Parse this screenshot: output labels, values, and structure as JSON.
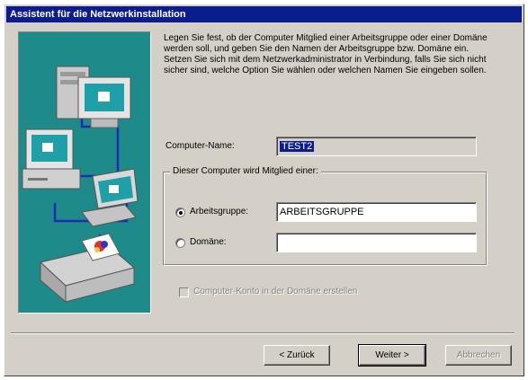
{
  "window": {
    "title": "Assistent für die Netzwerkinstallation"
  },
  "intro_text": "Legen Sie fest, ob der Computer Mitglied einer Arbeitsgruppe oder einer Domäne werden soll, und geben Sie den Namen der Arbeitsgruppe bzw. Domäne ein. Setzen Sie sich mit dem Netzwerkadministrator in Verbindung, falls Sie sich nicht sicher sind, welche Option Sie wählen oder welchen Namen Sie eingeben sollen.",
  "computer_name": {
    "label": "Computer-Name:",
    "value": "TEST2"
  },
  "membership": {
    "group_title": "Dieser Computer wird Mitglied einer:",
    "workgroup": {
      "label": "Arbeitsgruppe:",
      "value": "ARBEITSGRUPPE",
      "selected": true
    },
    "domain": {
      "label": "Domäne:",
      "value": "",
      "selected": false
    }
  },
  "create_account": {
    "label": "Computer-Konto in der Domäne erstellen",
    "checked": false,
    "enabled": false
  },
  "buttons": {
    "back": "< Zurück",
    "next": "Weiter >",
    "cancel": "Abbrechen"
  },
  "colors": {
    "titlebar": "#0b1c8f",
    "illustration_bg": "#1e8a8a",
    "dialog_bg": "#d4d0c8"
  }
}
